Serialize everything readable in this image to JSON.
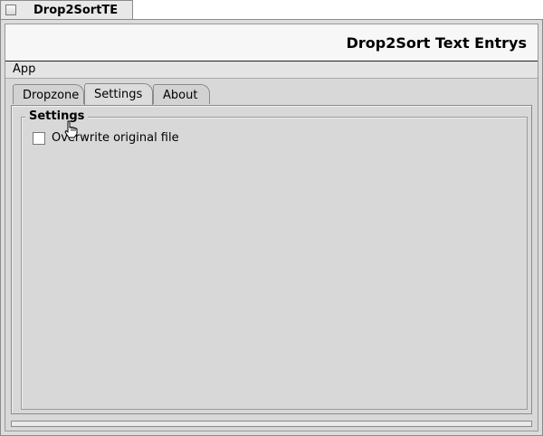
{
  "window": {
    "tab_title": "Drop2SortTE"
  },
  "header": {
    "title": "Drop2Sort Text Entrys"
  },
  "menubar": {
    "items": [
      {
        "label": "App"
      }
    ]
  },
  "tabs": [
    {
      "label": "Dropzone",
      "active": false
    },
    {
      "label": "Settings",
      "active": true
    },
    {
      "label": "About",
      "active": false
    }
  ],
  "settings": {
    "group_label": "Settings",
    "overwrite": {
      "label": "Overwrite original file",
      "checked": false
    }
  },
  "icons": {
    "close": "close-box-icon",
    "cursor": "hand-pointer-icon"
  },
  "colors": {
    "window_bg": "#dcdcdc",
    "header_bg": "#f7f7f7",
    "tab_border": "#8a8a8a"
  }
}
